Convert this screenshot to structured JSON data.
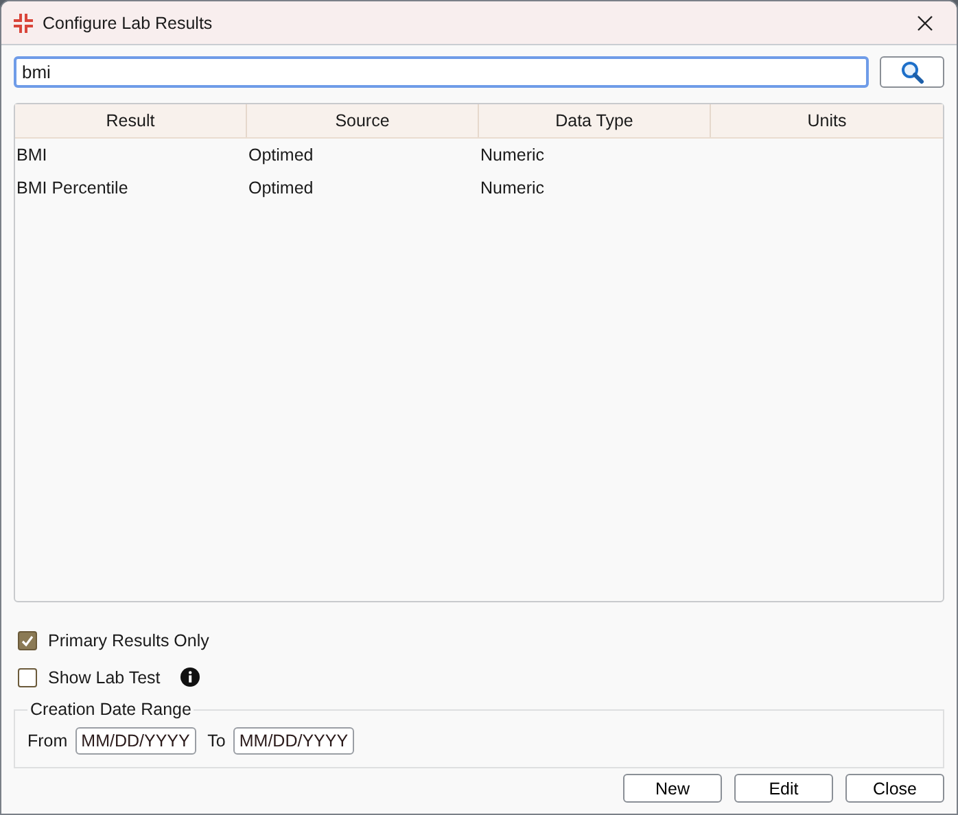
{
  "window": {
    "title": "Configure Lab Results"
  },
  "search": {
    "value": "bmi"
  },
  "table": {
    "columns": [
      "Result",
      "Source",
      "Data Type",
      "Units"
    ],
    "rows": [
      {
        "cells": [
          "BMI",
          "Optimed",
          "Numeric"
        ]
      },
      {
        "cells": [
          "BMI Percentile",
          "Optimed",
          "Numeric"
        ]
      }
    ]
  },
  "options": [
    {
      "label": "Primary Results Only",
      "checked": true,
      "info": false
    },
    {
      "label": "Show Lab Test",
      "checked": false,
      "info": true
    }
  ],
  "date_range": {
    "legend": "Creation Date Range",
    "from_label": "From",
    "from_placeholder": "MM/DD/YYYY",
    "to_label": "To",
    "to_placeholder": "MM/DD/YYYY"
  },
  "buttons": [
    "New",
    "Edit",
    "Close"
  ]
}
